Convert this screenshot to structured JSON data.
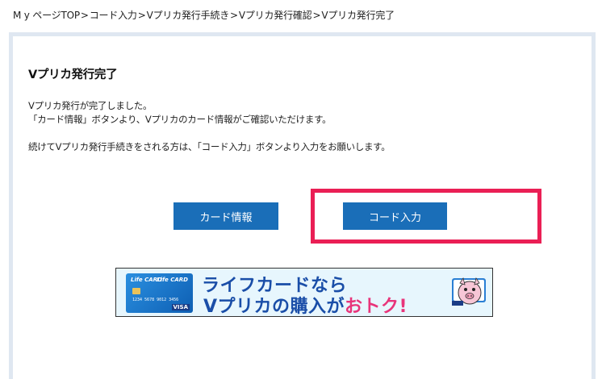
{
  "breadcrumb": {
    "items": [
      "M y ページTOP",
      "コード入力",
      "Vプリカ発行手続き",
      "Vプリカ発行確認",
      "Vプリカ発行完了"
    ],
    "separator": ">"
  },
  "page": {
    "title": "Vプリカ発行完了",
    "message_line1": "Vプリカ発行が完了しました。",
    "message_line2": "「カード情報」ボタンより、Vプリカのカード情報がご確認いただけます。",
    "message_line3": "続けてVプリカ発行手続きをされる方は、「コード入力」ボタンより入力をお願いします。"
  },
  "buttons": {
    "card_info": "カード情報",
    "code_input": "コード入力"
  },
  "banner": {
    "line1": "ライフカードなら",
    "line2_prefix": "Vプリカの購入が",
    "line2_accent": "おトク!",
    "card_brand": "Life CARD",
    "card_brand2": "Life CARD",
    "card_number": "1234 5678 9012 3456",
    "card_network": "VISA"
  },
  "colors": {
    "button_bg": "#1a6eb8",
    "highlight": "#ea1f55",
    "panel_border": "#dfe7f1",
    "banner_text": "#1a4ea8",
    "banner_accent": "#e8347a"
  }
}
